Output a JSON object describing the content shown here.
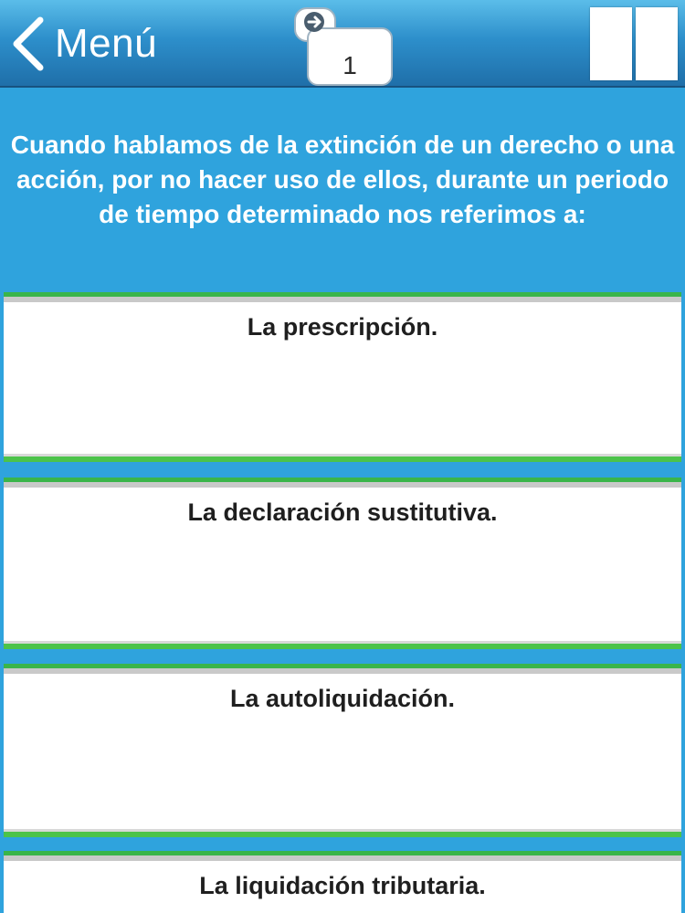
{
  "header": {
    "back_label": "Menú",
    "question_number": "1",
    "icons": {
      "back": "chevron-left-icon",
      "counter": "arrow-right-icon",
      "pause": "pause-icon"
    }
  },
  "question": {
    "text": "Cuando hablamos de la extinción de un derecho o una acción, por no hacer uso de ellos, durante un periodo de tiempo determinado nos referimos a:"
  },
  "answers": [
    {
      "label": "La prescripción."
    },
    {
      "label": "La declaración sustitutiva."
    },
    {
      "label": "La autoliquidación."
    },
    {
      "label": "La liquidación tributaria."
    }
  ],
  "colors": {
    "background": "#2fa3dd",
    "header": "#2d8fcb",
    "answer_accent": "#3ab54a"
  }
}
